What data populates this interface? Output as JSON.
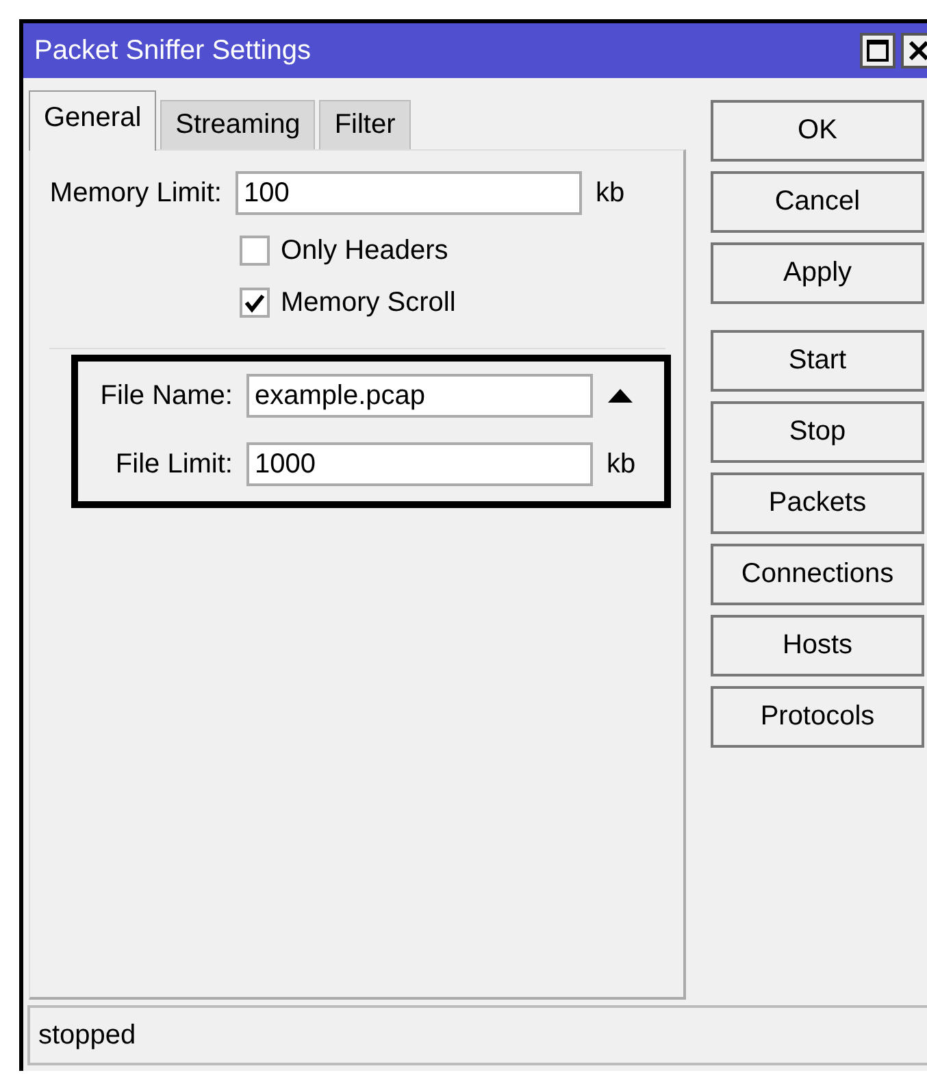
{
  "window": {
    "title": "Packet Sniffer Settings"
  },
  "tabs": [
    {
      "label": "General",
      "selected": true
    },
    {
      "label": "Streaming",
      "selected": false
    },
    {
      "label": "Filter",
      "selected": false
    }
  ],
  "memory_limit": {
    "label": "Memory Limit:",
    "value": "100",
    "unit": "kb"
  },
  "checkboxes": [
    {
      "label": "Only Headers",
      "checked": false
    },
    {
      "label": "Memory Scroll",
      "checked": true
    }
  ],
  "highlighted_fields": [
    {
      "kind": "dropdown",
      "label": "File Name:",
      "value": "example.pcap"
    },
    {
      "kind": "unit",
      "label": "File Limit:",
      "value": "1000",
      "unit": "kb"
    }
  ],
  "buttons": [
    [
      "OK",
      "Cancel",
      "Apply"
    ],
    [
      "Start",
      "Stop",
      "Packets",
      "Connections",
      "Hosts",
      "Protocols"
    ]
  ],
  "status_bar": "stopped"
}
